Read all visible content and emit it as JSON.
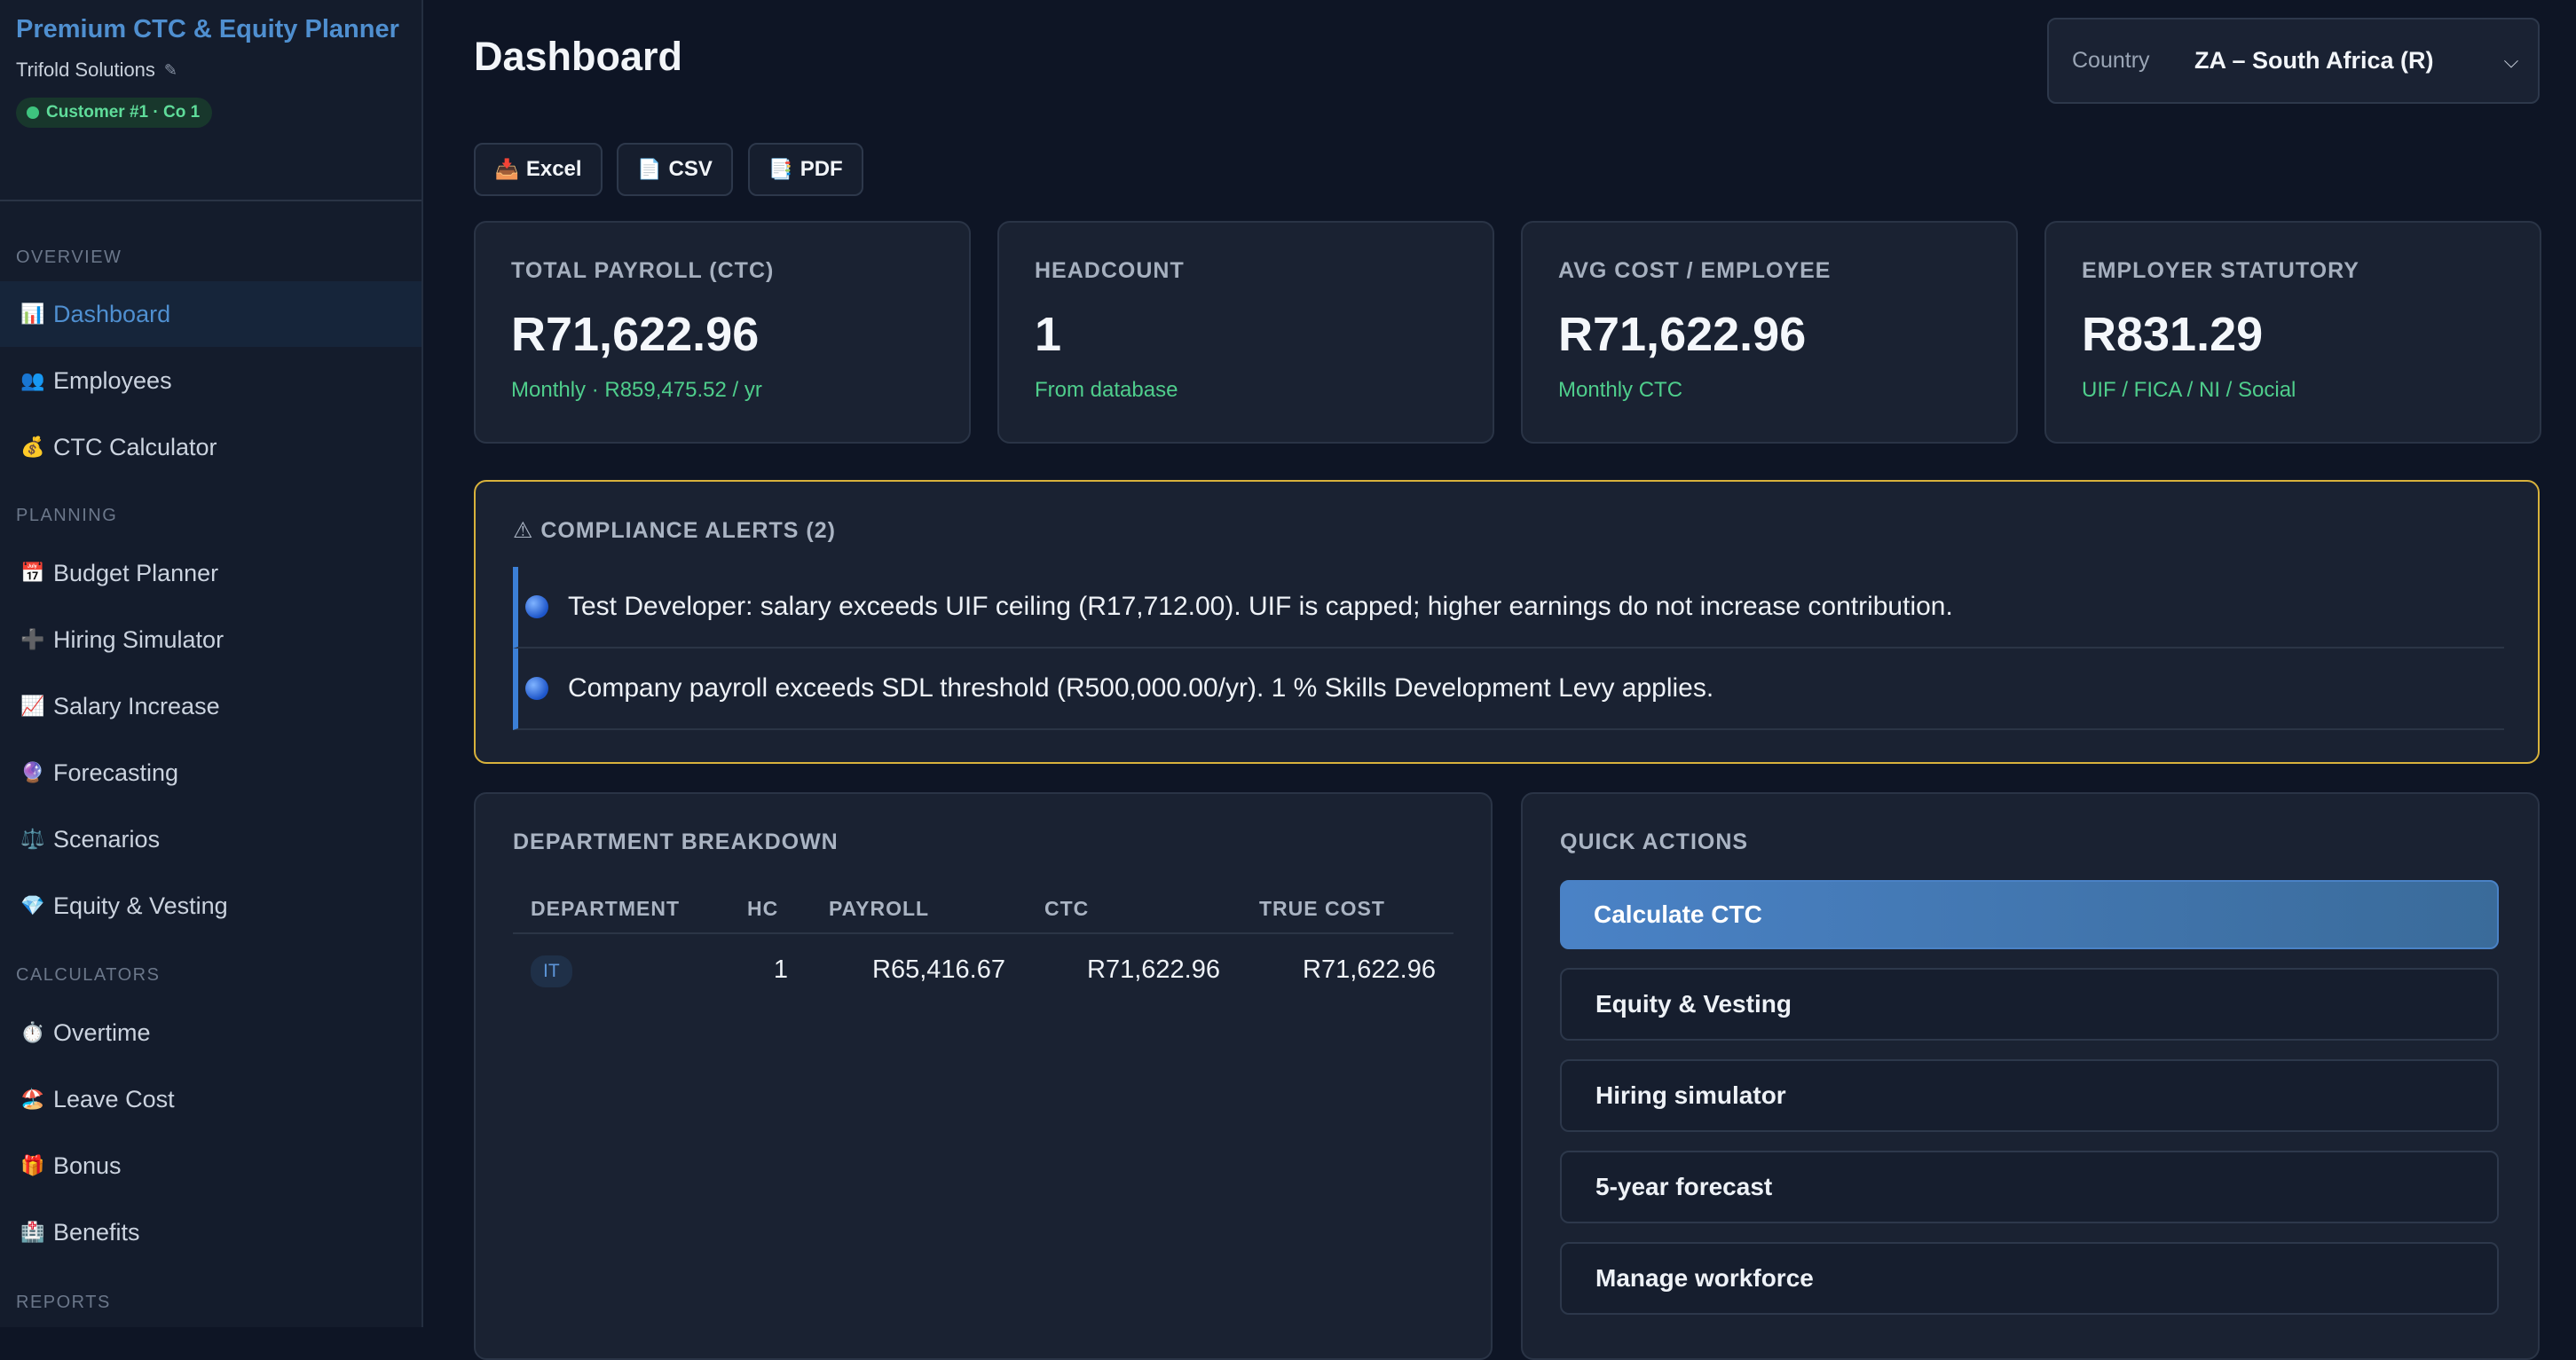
{
  "sidebar": {
    "brand_title": "Premium CTC & Equity Planner",
    "company": "Trifold Solutions",
    "edit_glyph": "✎",
    "customer_badge": "Customer #1 · Co 1",
    "sections": {
      "overview": "OVERVIEW",
      "planning": "PLANNING",
      "calculators": "CALCULATORS",
      "reports": "REPORTS"
    },
    "items": [
      {
        "icon": "📊",
        "label": "Dashboard",
        "active": true
      },
      {
        "icon": "👥",
        "label": "Employees"
      },
      {
        "icon": "💰",
        "label": "CTC Calculator"
      },
      {
        "icon": "📅",
        "label": "Budget Planner"
      },
      {
        "icon": "➕",
        "label": "Hiring Simulator"
      },
      {
        "icon": "📈",
        "label": "Salary Increase"
      },
      {
        "icon": "🔮",
        "label": "Forecasting"
      },
      {
        "icon": "⚖️",
        "label": "Scenarios"
      },
      {
        "icon": "💎",
        "label": "Equity & Vesting"
      },
      {
        "icon": "⏱️",
        "label": "Overtime"
      },
      {
        "icon": "🏖️",
        "label": "Leave Cost"
      },
      {
        "icon": "🎁",
        "label": "Bonus"
      },
      {
        "icon": "🏥",
        "label": "Benefits"
      }
    ]
  },
  "header": {
    "title": "Dashboard",
    "country_label": "Country",
    "country_value": "ZA – South Africa (R)",
    "chevron_glyph": "⌵"
  },
  "exports": [
    {
      "icon": "📥",
      "label": "Excel"
    },
    {
      "icon": "📄",
      "label": "CSV"
    },
    {
      "icon": "📑",
      "label": "PDF"
    }
  ],
  "stats": [
    {
      "label": "TOTAL PAYROLL (CTC)",
      "value": "R71,622.96",
      "sub": "Monthly · R859,475.52 / yr"
    },
    {
      "label": "HEADCOUNT",
      "value": "1",
      "sub": "From database"
    },
    {
      "label": "AVG COST / EMPLOYEE",
      "value": "R71,622.96",
      "sub": "Monthly CTC"
    },
    {
      "label": "EMPLOYER STATUTORY",
      "value": "R831.29",
      "sub": "UIF / FICA / NI / Social"
    }
  ],
  "alerts": {
    "title": "⚠ COMPLIANCE ALERTS (2)",
    "items": [
      "Test Developer: salary exceeds UIF ceiling (R17,712.00). UIF is capped; higher earnings do not increase contribution.",
      "Company payroll exceeds SDL threshold (R500,000.00/yr). 1 % Skills Development Levy applies."
    ]
  },
  "department": {
    "title": "DEPARTMENT BREAKDOWN",
    "columns": [
      "DEPARTMENT",
      "HC",
      "PAYROLL",
      "CTC",
      "TRUE COST"
    ],
    "rows": [
      {
        "department": "IT",
        "hc": "1",
        "payroll": "R65,416.67",
        "ctc": "R71,622.96",
        "true_cost": "R71,622.96"
      }
    ]
  },
  "quick_actions": {
    "title": "QUICK ACTIONS",
    "items": [
      "Calculate CTC",
      "Equity & Vesting",
      "Hiring simulator",
      "5-year forecast",
      "Manage workforce"
    ]
  },
  "colors": {
    "background": "#0e1525",
    "accent": "#4f8fd0",
    "positive": "#4fce8c",
    "alert_border": "#d8b23c"
  }
}
